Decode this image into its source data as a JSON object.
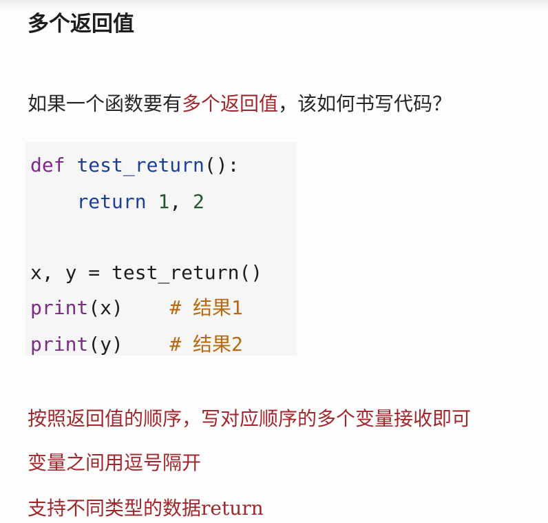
{
  "heading": "多个返回值",
  "intro": {
    "before": "如果一个函数要有",
    "highlight": "多个返回值",
    "after": "，该如何书写代码？"
  },
  "code": {
    "line1": {
      "kw": "def",
      "fn": "test_return",
      "rest": "():"
    },
    "line2": {
      "indent": "    ",
      "kw": "return",
      "num1": "1",
      "sep": ", ",
      "num2": "2"
    },
    "line4": {
      "vars": "x, y = ",
      "fn": "test_return",
      "rest": "()"
    },
    "line5": {
      "kw": "print",
      "args": "(x)",
      "pad": "    ",
      "comment": "# 结果1"
    },
    "line6": {
      "kw": "print",
      "args": "(y)",
      "pad": "    ",
      "comment": "# 结果2"
    }
  },
  "notes": [
    "按照返回值的顺序，写对应顺序的多个变量接收即可",
    "变量之间用逗号隔开",
    "支持不同类型的数据return"
  ]
}
